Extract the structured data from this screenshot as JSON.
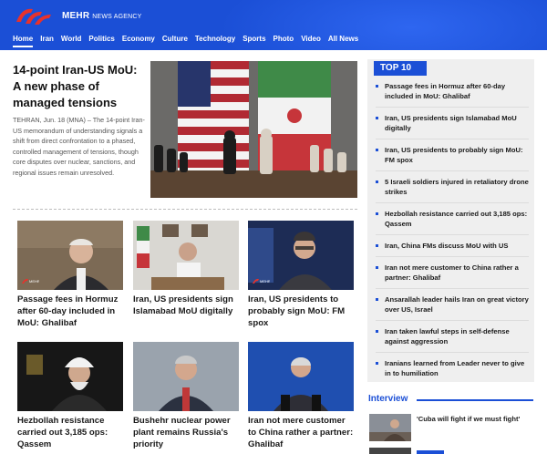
{
  "brand": {
    "name": "MEHR",
    "suffix": "NEWS AGENCY"
  },
  "nav": [
    "Home",
    "Iran",
    "World",
    "Politics",
    "Economy",
    "Culture",
    "Technology",
    "Sports",
    "Photo",
    "Video",
    "All News"
  ],
  "lead": {
    "title": "14-point Iran-US MoU: A new phase of managed tensions",
    "summary": "TEHRAN, Jun. 18 (MNA) – The 14-point Iran-US memorandum of understanding signals a shift from direct confrontation to a phased, controlled management of tensions, though core disputes over nuclear, sanctions, and regional issues remain unresolved."
  },
  "cards": [
    {
      "caption": "Passage fees in Hormuz after 60-day included in MoU: Ghalibaf"
    },
    {
      "caption": "Iran, US presidents sign Islamabad MoU digitally"
    },
    {
      "caption": "Iran, US presidents to probably sign MoU: FM spox"
    },
    {
      "caption": "Hezbollah resistance carried out 3,185 ops: Qassem"
    },
    {
      "caption": "Bushehr nuclear power plant remains Russia's priority"
    },
    {
      "caption": "Iran not mere customer to China rather a partner: Ghalibaf"
    }
  ],
  "top10": {
    "title": "TOP 10",
    "items": [
      "Passage fees in Hormuz after 60-day included in MoU: Ghalibaf",
      "Iran, US presidents sign Islamabad MoU digitally",
      "Iran, US presidents to probably sign MoU: FM spox",
      "5 Israeli soldiers injured in retaliatory drone strikes",
      "Hezbollah resistance carried out 3,185 ops: Qassem",
      "Iran, China FMs discuss MoU with US",
      "Iran not mere customer to China rather a partner: Ghalibaf",
      "Ansarallah leader hails Iran on great victory over US, Israel",
      "Iran taken lawful steps in self-defense against aggression",
      "Iranians learned from Leader never to give in to humiliation"
    ]
  },
  "interview": {
    "title": "Interview",
    "item": "'Cuba will fight if we must fight'"
  },
  "colors": {
    "brand_blue": "#1b4fd6",
    "panel_gray": "#efefef"
  }
}
